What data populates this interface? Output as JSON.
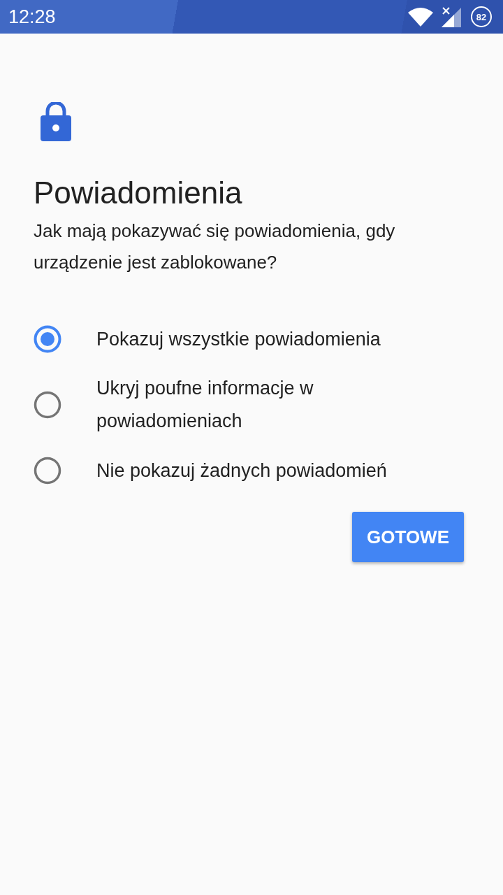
{
  "status_bar": {
    "time": "12:28",
    "battery": "82"
  },
  "title": "Powiadomienia",
  "subtitle": "Jak mają pokazywać się powiadomienia, gdy urządzenie jest zablokowane?",
  "options": [
    {
      "label": "Pokazuj wszystkie powiadomienia",
      "selected": true
    },
    {
      "label": "Ukryj poufne informacje w powiadomieniach",
      "selected": false
    },
    {
      "label": "Nie pokazuj żadnych powiadomień",
      "selected": false
    }
  ],
  "buttons": [
    "GOTOWE"
  ]
}
